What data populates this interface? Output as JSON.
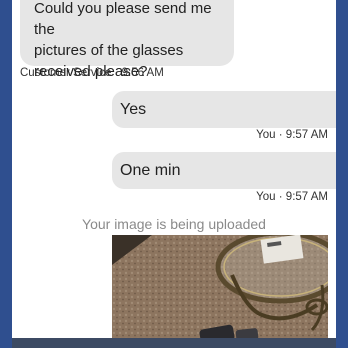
{
  "messages": {
    "agent": {
      "lines": [
        "Could you please send me the",
        "pictures of the glasses",
        "received please?"
      ],
      "meta": "Customer Service · 9:56 AM"
    },
    "user1": {
      "text": "Yes",
      "meta": "You · 9:57 AM"
    },
    "user2": {
      "text": "One min",
      "meta": "You · 9:57 AM"
    }
  },
  "upload": {
    "status": "Your image is being uploaded"
  },
  "colors": {
    "outer_frame": "#2f4f8f",
    "bubble": "#e6e6e6",
    "status_text": "#8a8a8a"
  }
}
